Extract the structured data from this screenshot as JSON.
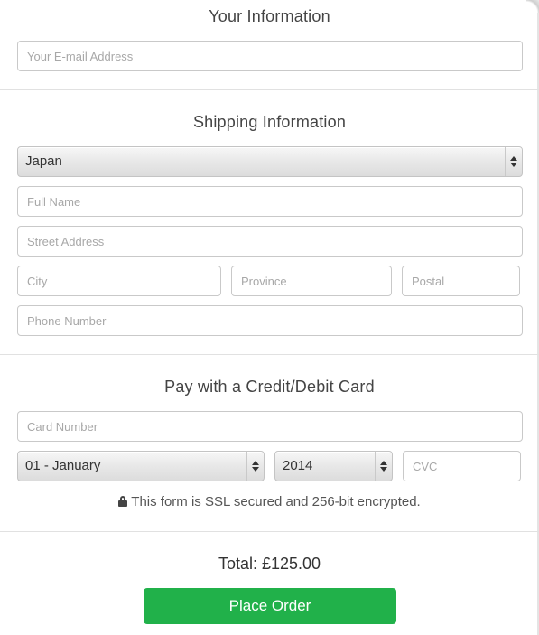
{
  "your_info": {
    "title": "Your Information",
    "email_placeholder": "Your E-mail Address"
  },
  "shipping": {
    "title": "Shipping Information",
    "country_selected": "Japan",
    "full_name_placeholder": "Full Name",
    "street_placeholder": "Street Address",
    "city_placeholder": "City",
    "province_placeholder": "Province",
    "postal_placeholder": "Postal",
    "phone_placeholder": "Phone Number"
  },
  "payment": {
    "title": "Pay with a Credit/Debit Card",
    "card_number_placeholder": "Card Number",
    "month_selected": "01 - January",
    "year_selected": "2014",
    "cvc_placeholder": "CVC",
    "ssl_note": "This form is SSL secured and 256-bit encrypted."
  },
  "order": {
    "total": "Total: £125.00",
    "place_order_label": "Place Order"
  },
  "colors": {
    "button_green": "#21b14a",
    "divider": "#e1e1e1",
    "field_border": "#c9c9c9"
  },
  "icons": {
    "lock": "lock-icon",
    "select_arrows": "select-arrows-icon"
  }
}
